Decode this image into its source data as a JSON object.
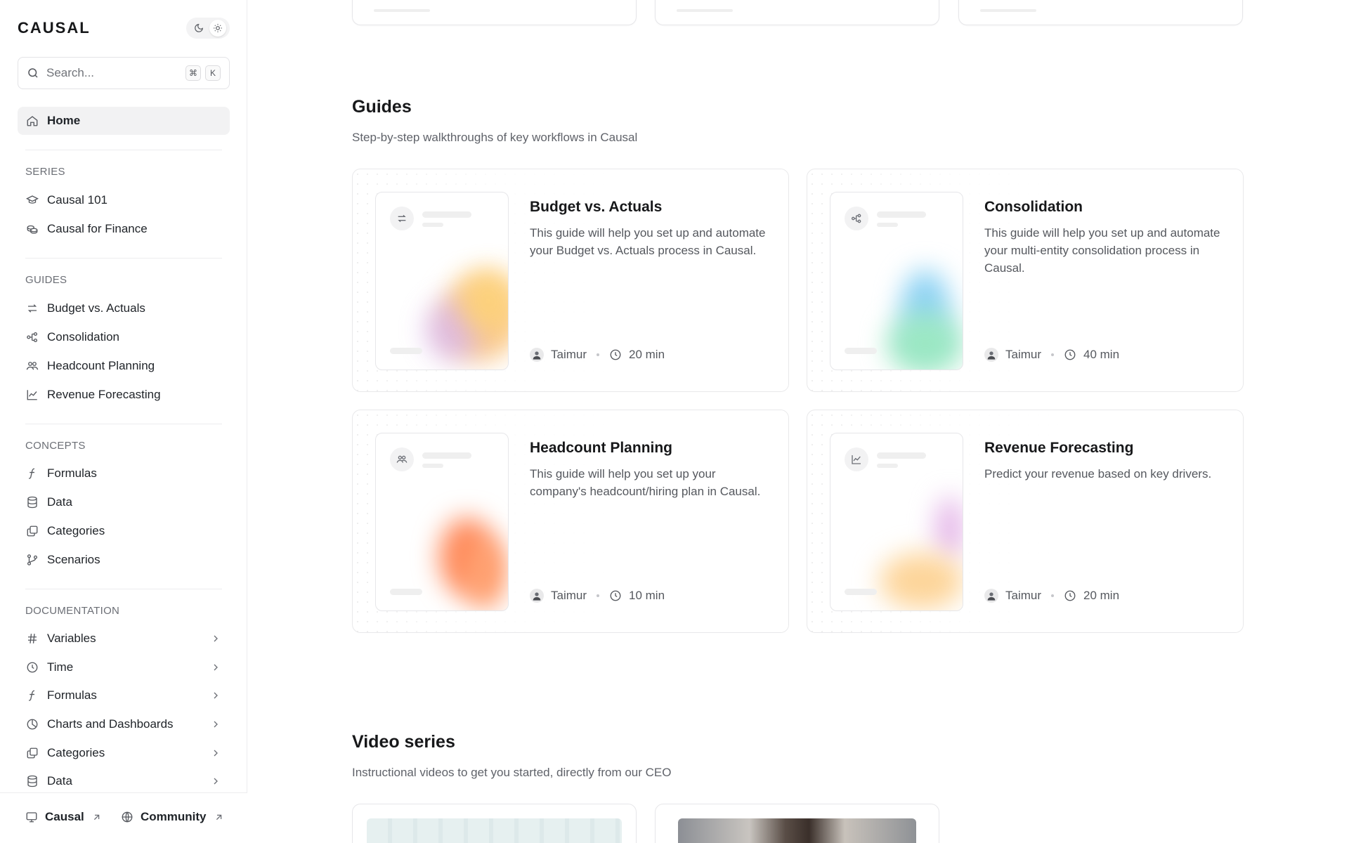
{
  "sidebar": {
    "logo": "CAUSAL",
    "search": {
      "placeholder": "Search...",
      "shortcut_mod": "⌘",
      "shortcut_key": "K"
    },
    "home": {
      "label": "Home"
    },
    "sections": {
      "series": {
        "title": "SERIES",
        "items": [
          {
            "label": "Causal 101",
            "icon": "graduation-cap-icon"
          },
          {
            "label": "Causal for Finance",
            "icon": "coins-icon"
          }
        ]
      },
      "guides": {
        "title": "GUIDES",
        "items": [
          {
            "label": "Budget vs. Actuals",
            "icon": "arrows-swap-icon"
          },
          {
            "label": "Consolidation",
            "icon": "nodes-icon"
          },
          {
            "label": "Headcount Planning",
            "icon": "people-icon"
          },
          {
            "label": "Revenue Forecasting",
            "icon": "line-chart-icon"
          }
        ]
      },
      "concepts": {
        "title": "CONCEPTS",
        "items": [
          {
            "label": "Formulas",
            "icon": "function-icon"
          },
          {
            "label": "Data",
            "icon": "database-icon"
          },
          {
            "label": "Categories",
            "icon": "layers-icon"
          },
          {
            "label": "Scenarios",
            "icon": "git-branch-icon"
          }
        ]
      },
      "documentation": {
        "title": "DOCUMENTATION",
        "items": [
          {
            "label": "Variables",
            "icon": "hash-icon"
          },
          {
            "label": "Time",
            "icon": "clock-icon"
          },
          {
            "label": "Formulas",
            "icon": "function-icon"
          },
          {
            "label": "Charts and Dashboards",
            "icon": "pie-chart-icon"
          },
          {
            "label": "Categories",
            "icon": "layers-icon"
          },
          {
            "label": "Data",
            "icon": "database-icon"
          }
        ]
      }
    },
    "footer": {
      "causal": {
        "label": "Causal"
      },
      "community": {
        "label": "Community"
      }
    }
  },
  "main": {
    "guides": {
      "heading": "Guides",
      "subheading": "Step-by-step walkthroughs of key workflows in Causal",
      "cards": [
        {
          "title": "Budget vs. Actuals",
          "description": "This guide will help you set up and automate your Budget vs. Actuals process in Causal.",
          "author": "Taimur",
          "duration": "20 min"
        },
        {
          "title": "Consolidation",
          "description": "This guide will help you set up and automate your multi-entity consolidation process in Causal.",
          "author": "Taimur",
          "duration": "40 min"
        },
        {
          "title": "Headcount Planning",
          "description": "This guide will help you set up your company's headcount/hiring plan in Causal.",
          "author": "Taimur",
          "duration": "10 min"
        },
        {
          "title": "Revenue Forecasting",
          "description": "Predict your revenue based on key drivers.",
          "author": "Taimur",
          "duration": "20 min"
        }
      ]
    },
    "video_series": {
      "heading": "Video series",
      "subheading": "Instructional videos to get you started, directly from our CEO"
    }
  }
}
